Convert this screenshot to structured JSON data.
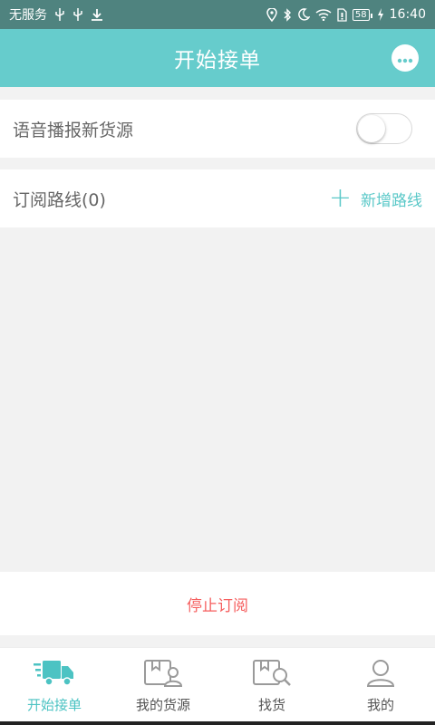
{
  "status_bar": {
    "carrier": "无服务",
    "battery": "58",
    "time": "16:40",
    "icons_left": [
      "usb-icon",
      "usb-icon",
      "download-icon"
    ],
    "icons_right": [
      "location-icon",
      "bluetooth-icon",
      "moon-icon",
      "wifi-icon",
      "sim-icon",
      "battery-icon",
      "charging-icon"
    ]
  },
  "header": {
    "title": "开始接单",
    "icon": "chat-icon",
    "accent_color": "#66cccc"
  },
  "voice_row": {
    "label": "语音播报新货源",
    "toggle_on": false
  },
  "routes_row": {
    "label": "订阅路线(0)",
    "add_label": "新增路线"
  },
  "stop": {
    "label": "停止订阅",
    "color": "#f55e5e"
  },
  "tabs": [
    {
      "label": "开始接单",
      "icon": "truck-icon",
      "active": true
    },
    {
      "label": "我的货源",
      "icon": "box-user-icon",
      "active": false
    },
    {
      "label": "找货",
      "icon": "box-search-icon",
      "active": false
    },
    {
      "label": "我的",
      "icon": "person-icon",
      "active": false
    }
  ]
}
